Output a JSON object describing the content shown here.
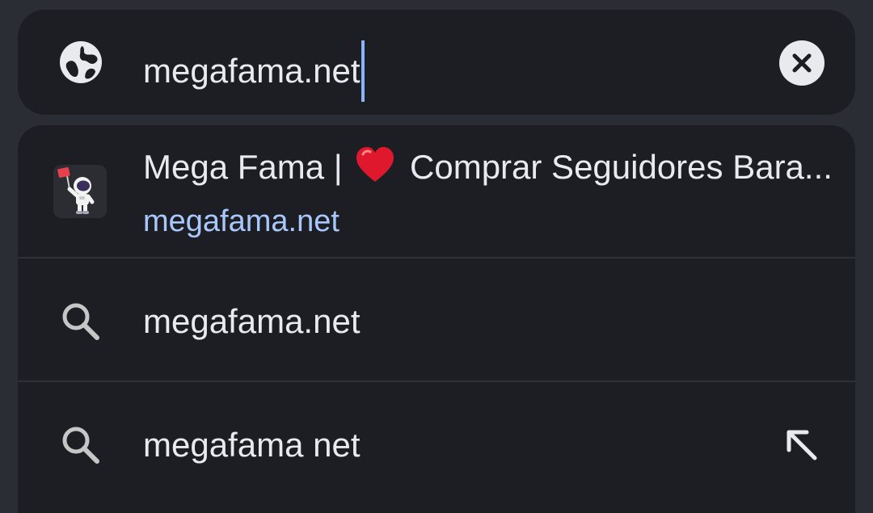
{
  "omnibox": {
    "url_text": "megafama.net",
    "globe_icon": "globe-icon",
    "clear_icon": "clear-icon"
  },
  "suggestions": [
    {
      "type": "site",
      "title_prefix": "Mega Fama |",
      "title_emoji": "❤️",
      "title_suffix": "Comprar Seguidores Bara...",
      "url": "megafama.net",
      "icon": "astronaut-favicon"
    },
    {
      "type": "search",
      "text": "megafama.net",
      "icon": "search-icon"
    },
    {
      "type": "search",
      "text": "megafama net",
      "icon": "search-icon",
      "action_icon": "arrow-up-left-icon"
    }
  ],
  "colors": {
    "background": "#2a2d33",
    "panel": "#1c1e24",
    "text": "#e8eaed",
    "link": "#a8c7fa",
    "caret": "#8ab4f8",
    "heart": "#e0182d"
  }
}
